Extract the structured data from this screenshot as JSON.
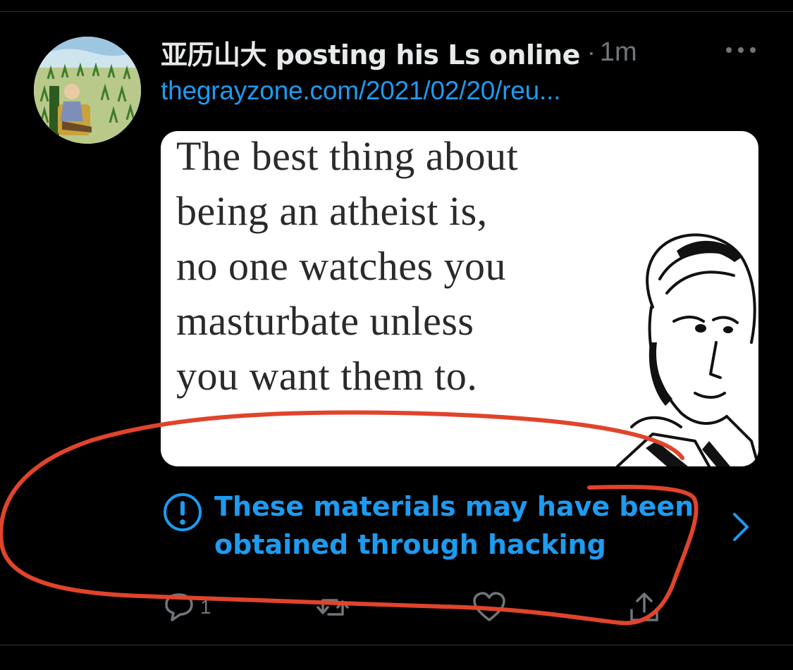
{
  "tweet": {
    "display_name": "亚历山大 posting his Ls online",
    "separator": "·",
    "timestamp": "1m",
    "link": "thegrayzone.com/2021/02/20/reu...",
    "media": {
      "meme_lines": [
        "The best thing about",
        "being an atheist is,",
        "no one watches you",
        "masturbate unless",
        "you want them to."
      ]
    },
    "warning": {
      "line1": "These materials may have been",
      "line2": "obtained through hacking",
      "icon": "exclamation-circle-icon",
      "chevron": "chevron-right-icon"
    },
    "actions": {
      "reply_count": "1",
      "icons": [
        "reply-icon",
        "retweet-icon",
        "like-icon",
        "share-icon"
      ]
    }
  },
  "colors": {
    "background": "#000000",
    "text_primary": "#e7e9ea",
    "text_secondary": "#71767b",
    "accent": "#1d9bf0",
    "annotation": "#e0442b"
  }
}
